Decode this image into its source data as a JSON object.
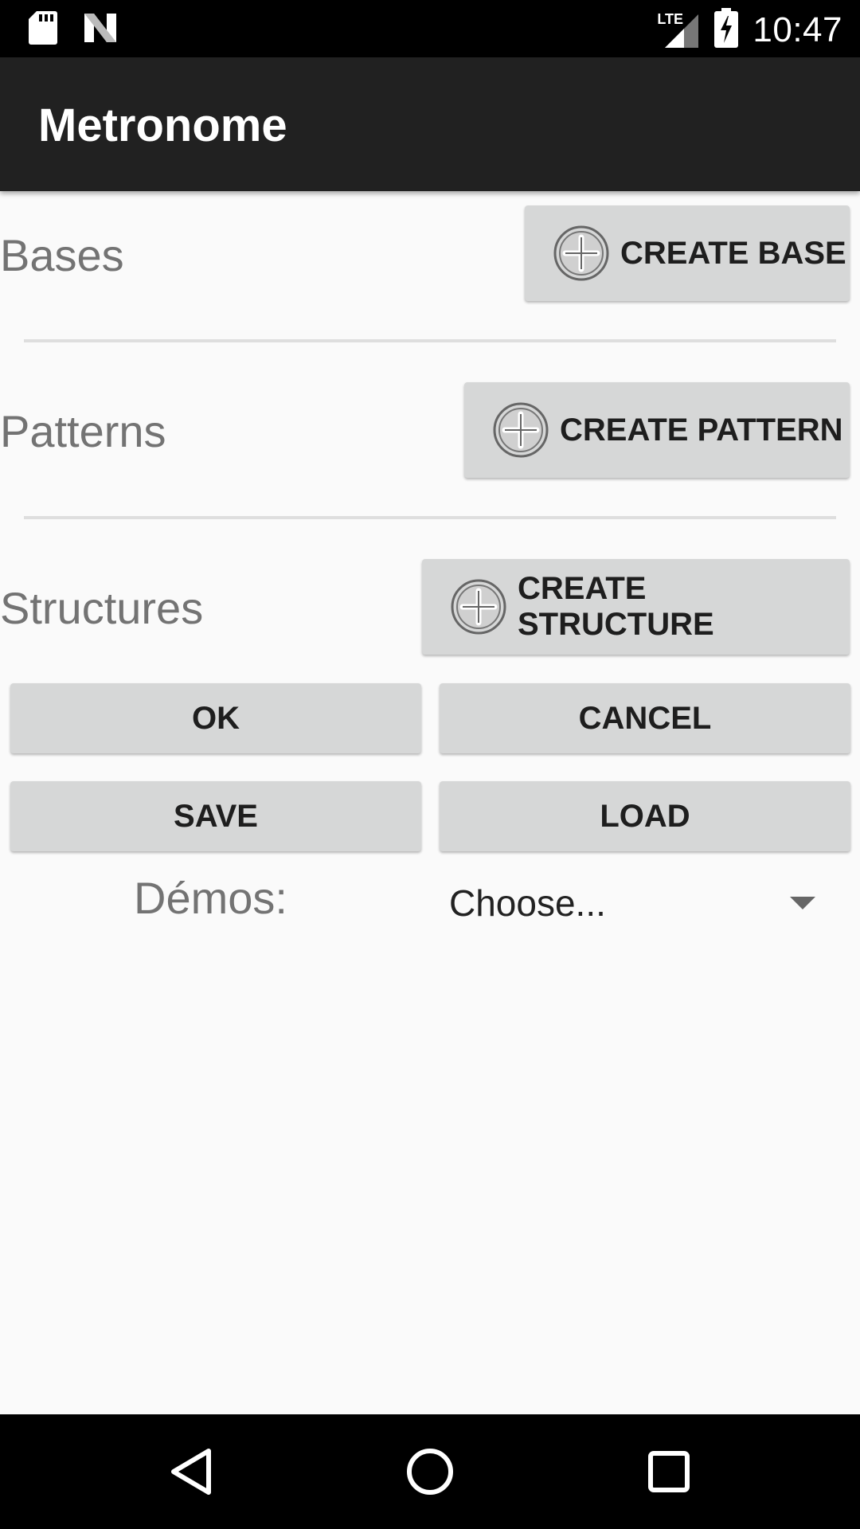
{
  "status_bar": {
    "time": "10:47",
    "network_label": "LTE",
    "icons": [
      "sd-card-icon",
      "n-logo-icon",
      "signal-icon",
      "battery-charging-icon"
    ]
  },
  "app_bar": {
    "title": "Metronome"
  },
  "sections": [
    {
      "label": "Bases",
      "button_label": "CREATE BASE",
      "button_icon": "add-circle-icon"
    },
    {
      "label": "Patterns",
      "button_label": "CREATE PATTERN",
      "button_icon": "add-circle-icon"
    },
    {
      "label": "Structures",
      "button_label": "CREATE STRUCTURE",
      "button_icon": "add-circle-icon"
    }
  ],
  "actions": {
    "ok_label": "OK",
    "cancel_label": "CANCEL",
    "save_label": "SAVE",
    "load_label": "LOAD"
  },
  "demos": {
    "label": "Démos:",
    "selected": "Choose..."
  },
  "nav_bar": {
    "icons": [
      "back-icon",
      "home-icon",
      "recents-icon"
    ]
  },
  "colors": {
    "status_bar": "#000000",
    "app_bar": "#212121",
    "background": "#fafafa",
    "button": "#d6d7d7",
    "label_text": "#737373"
  }
}
